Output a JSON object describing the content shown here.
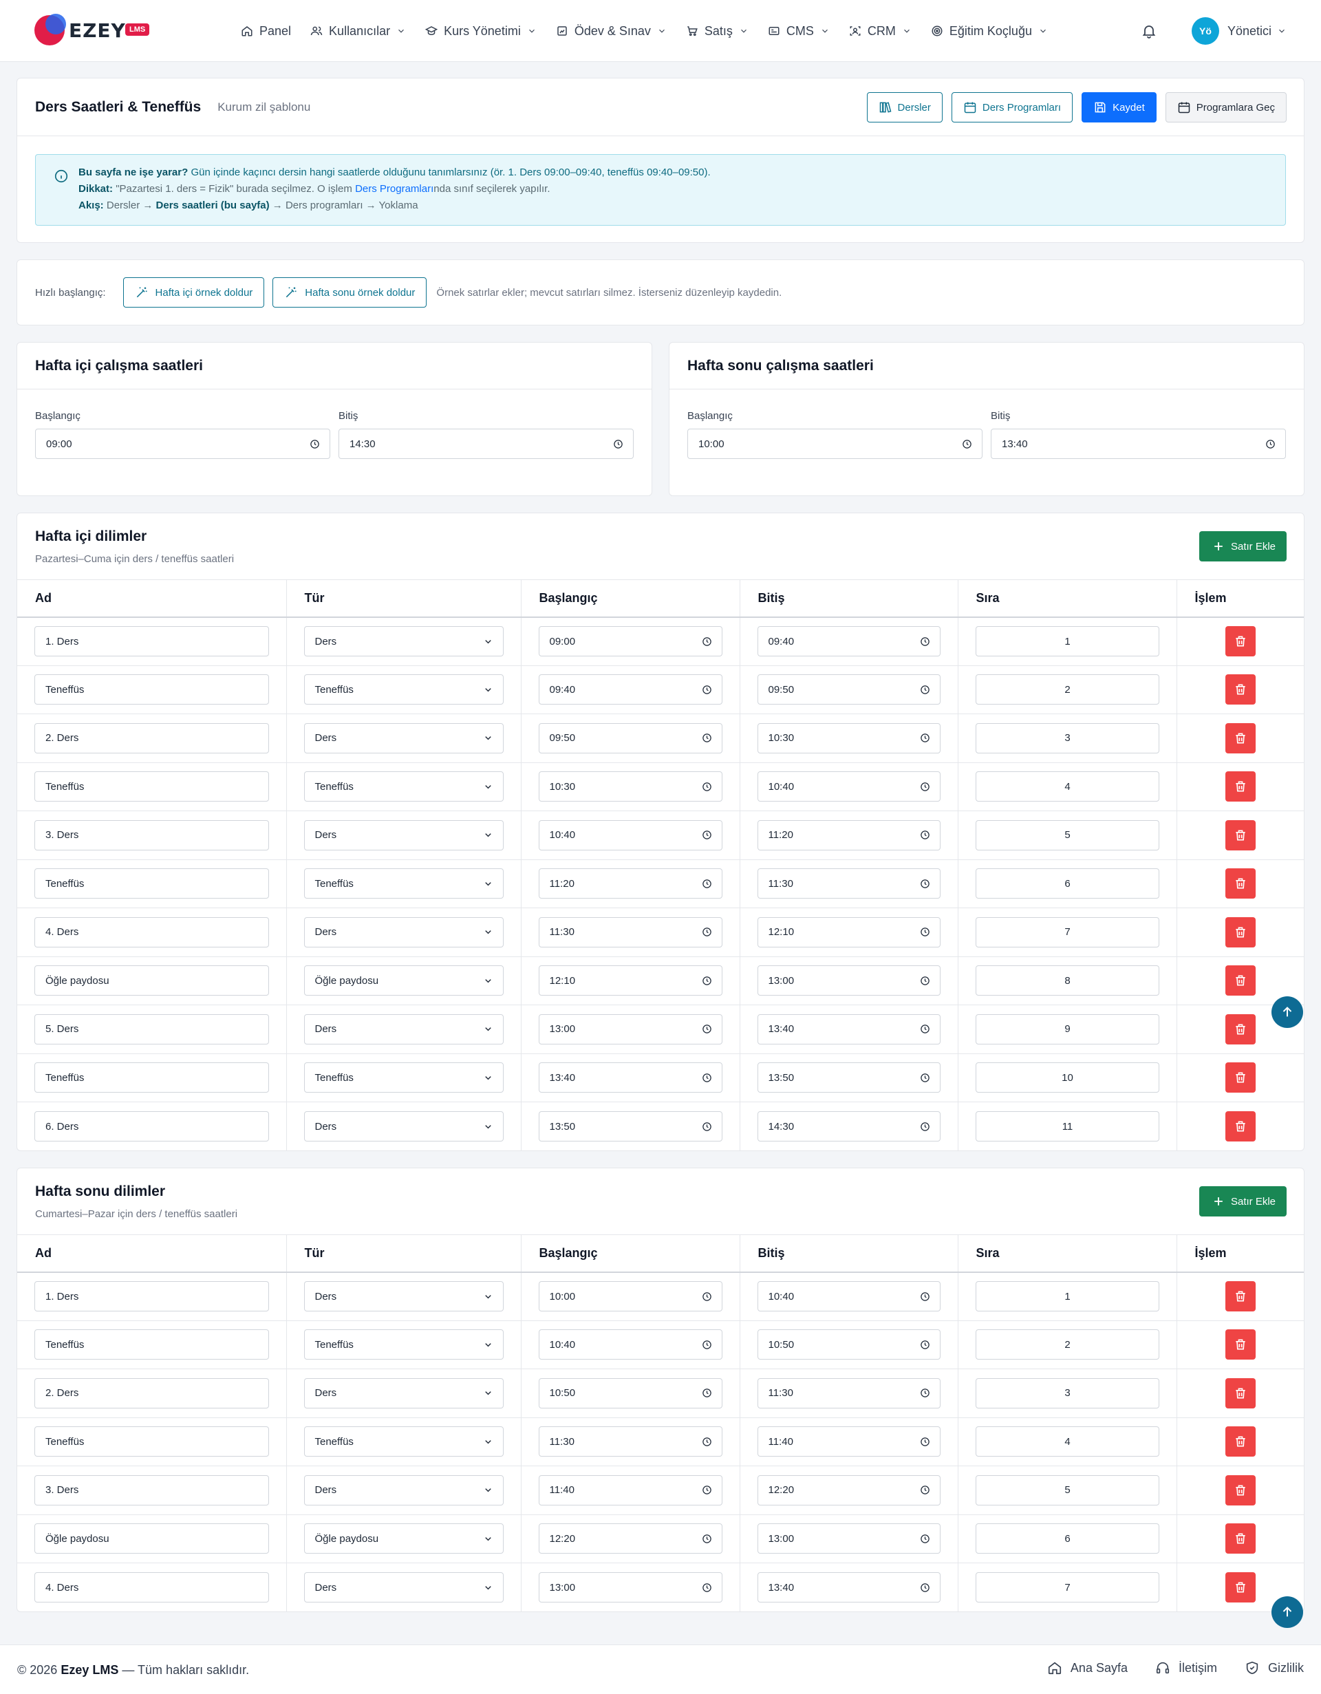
{
  "brand": {
    "name": "EZEY",
    "badge": "LMS"
  },
  "nav": {
    "items": [
      {
        "label": "Panel",
        "icon": "home-icon"
      },
      {
        "label": "Kullanıcılar",
        "icon": "users-icon"
      },
      {
        "label": "Kurs Yönetimi",
        "icon": "graduation-cap-icon"
      },
      {
        "label": "Ödev & Sınav",
        "icon": "clipboard-icon"
      },
      {
        "label": "Satış",
        "icon": "cart-icon"
      },
      {
        "label": "CMS",
        "icon": "cms-icon"
      },
      {
        "label": "CRM",
        "icon": "crm-icon"
      },
      {
        "label": "Eğitim Koçluğu",
        "icon": "target-icon"
      }
    ],
    "avatar_initials": "Yö",
    "user_name": "Yönetici"
  },
  "header": {
    "title": "Ders Saatleri & Teneffüs",
    "subtitle": "Kurum zil şablonu",
    "btn_courses": "Dersler",
    "btn_schedules": "Ders Programları",
    "btn_save": "Kaydet",
    "btn_go_programs": "Programlara Geç"
  },
  "info": {
    "q": "Bu sayfa ne işe yarar?",
    "answer": "Gün içinde kaçıncı dersin hangi saatlerde olduğunu tanımlarsınız (ör. 1. Ders 09:00–09:40, teneffüs 09:40–09:50).",
    "warn_label": "Dikkat:",
    "warn_text1": "\"Pazartesi 1. ders = Fizik\" burada seçilmez. O işlem",
    "warn_link": "Ders Programları",
    "warn_text2": "nda sınıf seçilerek yapılır.",
    "flow_label": "Akış:",
    "flow_text1": "Dersler → ",
    "flow_bold": "Ders saatleri (bu sayfa)",
    "flow_text2": " → Ders programları → Yoklama"
  },
  "quick": {
    "label": "Hızlı başlangıç:",
    "btn_weekday": "Hafta içi örnek doldur",
    "btn_weekend": "Hafta sonu örnek doldur",
    "note": "Örnek satırlar ekler; mevcut satırları silmez. İsterseniz düzenleyip kaydedin."
  },
  "weekday_hours": {
    "title": "Hafta içi çalışma saatleri",
    "start_label": "Başlangıç",
    "start": "09:00",
    "end_label": "Bitiş",
    "end": "14:30"
  },
  "weekend_hours": {
    "title": "Hafta sonu çalışma saatleri",
    "start_label": "Başlangıç",
    "start": "10:00",
    "end_label": "Bitiş",
    "end": "13:40"
  },
  "columns": [
    "Ad",
    "Tür",
    "Başlangıç",
    "Bitiş",
    "Sıra",
    "İşlem"
  ],
  "add_row_label": "Satır Ekle",
  "weekday_slices": {
    "title": "Hafta içi dilimler",
    "subtitle": "Pazartesi–Cuma için ders / teneffüs saatleri",
    "rows": [
      {
        "ad": "1. Ders",
        "tur": "Ders",
        "bas": "09:00",
        "bit": "09:40",
        "sira": "1"
      },
      {
        "ad": "Teneffüs",
        "tur": "Teneffüs",
        "bas": "09:40",
        "bit": "09:50",
        "sira": "2"
      },
      {
        "ad": "2. Ders",
        "tur": "Ders",
        "bas": "09:50",
        "bit": "10:30",
        "sira": "3"
      },
      {
        "ad": "Teneffüs",
        "tur": "Teneffüs",
        "bas": "10:30",
        "bit": "10:40",
        "sira": "4"
      },
      {
        "ad": "3. Ders",
        "tur": "Ders",
        "bas": "10:40",
        "bit": "11:20",
        "sira": "5"
      },
      {
        "ad": "Teneffüs",
        "tur": "Teneffüs",
        "bas": "11:20",
        "bit": "11:30",
        "sira": "6"
      },
      {
        "ad": "4. Ders",
        "tur": "Ders",
        "bas": "11:30",
        "bit": "12:10",
        "sira": "7"
      },
      {
        "ad": "Öğle paydosu",
        "tur": "Öğle paydosu",
        "bas": "12:10",
        "bit": "13:00",
        "sira": "8"
      },
      {
        "ad": "5. Ders",
        "tur": "Ders",
        "bas": "13:00",
        "bit": "13:40",
        "sira": "9"
      },
      {
        "ad": "Teneffüs",
        "tur": "Teneffüs",
        "bas": "13:40",
        "bit": "13:50",
        "sira": "10"
      },
      {
        "ad": "6. Ders",
        "tur": "Ders",
        "bas": "13:50",
        "bit": "14:30",
        "sira": "11"
      }
    ]
  },
  "weekend_slices": {
    "title": "Hafta sonu dilimler",
    "subtitle": "Cumartesi–Pazar için ders / teneffüs saatleri",
    "rows": [
      {
        "ad": "1. Ders",
        "tur": "Ders",
        "bas": "10:00",
        "bit": "10:40",
        "sira": "1"
      },
      {
        "ad": "Teneffüs",
        "tur": "Teneffüs",
        "bas": "10:40",
        "bit": "10:50",
        "sira": "2"
      },
      {
        "ad": "2. Ders",
        "tur": "Ders",
        "bas": "10:50",
        "bit": "11:30",
        "sira": "3"
      },
      {
        "ad": "Teneffüs",
        "tur": "Teneffüs",
        "bas": "11:30",
        "bit": "11:40",
        "sira": "4"
      },
      {
        "ad": "3. Ders",
        "tur": "Ders",
        "bas": "11:40",
        "bit": "12:20",
        "sira": "5"
      },
      {
        "ad": "Öğle paydosu",
        "tur": "Öğle paydosu",
        "bas": "12:20",
        "bit": "13:00",
        "sira": "6"
      },
      {
        "ad": "4. Ders",
        "tur": "Ders",
        "bas": "13:00",
        "bit": "13:40",
        "sira": "7"
      }
    ]
  },
  "footer": {
    "copyright_prefix": "© 2026",
    "brand": "Ezey LMS",
    "copyright_suffix": "— Tüm hakları saklıdır.",
    "links": [
      {
        "label": "Ana Sayfa",
        "icon": "home-icon"
      },
      {
        "label": "İletişim",
        "icon": "headset-icon"
      },
      {
        "label": "Gizlilik",
        "icon": "shield-icon"
      }
    ]
  },
  "colors": {
    "primary": "#0d6efd",
    "teal": "#0e7490",
    "success": "#198754",
    "danger": "#ef4444",
    "info_bg": "#e7f7fb",
    "avatar": "#0ea5d8"
  }
}
